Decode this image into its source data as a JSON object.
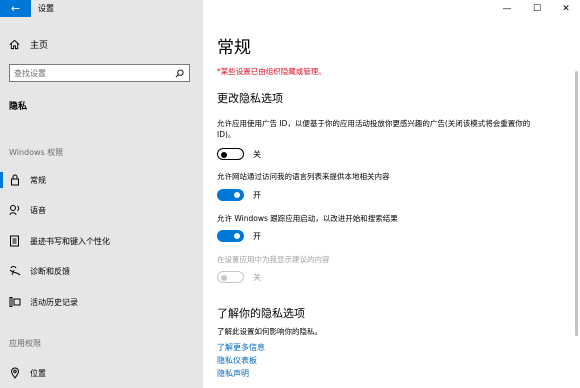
{
  "titlebar": {
    "app_title": "设置",
    "back_icon": "←",
    "minimize": "—",
    "maximize": "☐",
    "close": "✕"
  },
  "sidebar": {
    "home": "主页",
    "search_placeholder": "查找设置",
    "section_title": "隐私",
    "windows_group": "Windows 权限",
    "items": [
      {
        "label": "常规",
        "icon": "lock-icon"
      },
      {
        "label": "语音",
        "icon": "speech-icon"
      },
      {
        "label": "墨迹书写和键入个性化",
        "icon": "inking-icon"
      },
      {
        "label": "诊断和反馈",
        "icon": "diagnostics-icon"
      },
      {
        "label": "活动历史记录",
        "icon": "activity-history-icon"
      }
    ],
    "app_group": "应用权限",
    "app_items": [
      {
        "label": "位置",
        "icon": "location-icon"
      }
    ]
  },
  "main": {
    "title": "常规",
    "warning": "*某些设置已由组织隐藏或管理。",
    "section_heading": "更改隐私选项",
    "options": [
      {
        "desc": "允许应用使用广告 ID，以便基于你的应用活动投放你更感兴趣的广告(关闭该模式将会重置你的 ID)。",
        "state": "关"
      },
      {
        "desc": "允许网站通过访问我的语言列表来提供本地相关内容",
        "state": "开"
      },
      {
        "desc": "允许 Windows 跟踪应用启动，以改进开始和搜索结果",
        "state": "开"
      },
      {
        "desc": "在设置应用中为我显示建议的内容",
        "state": "关"
      }
    ],
    "learn_heading": "了解你的隐私选项",
    "learn_desc": "了解此设置如何影响你的隐私。",
    "links": [
      "了解更多信息",
      "隐私仪表板",
      "隐私声明"
    ]
  },
  "colors": {
    "accent": "#0078d7",
    "warning": "#e81123",
    "link": "#0067c0"
  }
}
